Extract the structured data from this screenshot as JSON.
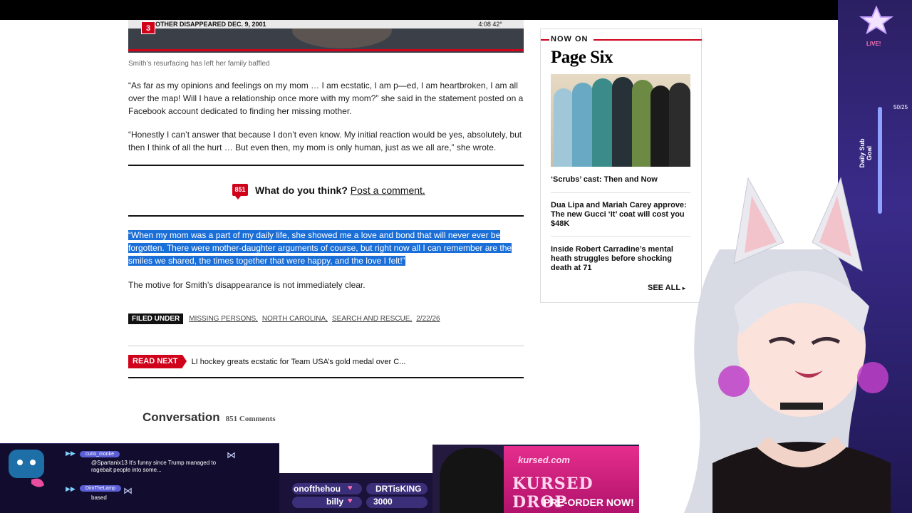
{
  "video": {
    "badge_num": "3",
    "ticker_left": "OTHER DISAPPEARED DEC. 9, 2001",
    "ticker_right": "4:08   42°"
  },
  "article": {
    "caption": "Smith’s resurfacing has left her family baffled",
    "paragraph1": "“As far as my opinions and feelings on my mom … I am ecstatic, I am p—ed, I am heartbroken, I am all over the map! Will I have a relationship once more with my mom?” she said in the statement posted on a Facebook account dedicated to finding her missing mother.",
    "paragraph2": "“Honestly I can’t answer that because I don’t even know. My initial reaction would be yes, absolutely, but then I think of all the hurt … But even then, my mom is only human, just as we all are,” she wrote.",
    "comment_count_badge": "851",
    "comment_prompt": "What do you think?",
    "comment_link": "Post a comment.",
    "quote": "“When my mom was a part of my daily life, she showed me a love and bond that will never ever be forgotten. There were mother-daughter arguments of course, but right now all I can remember are the smiles we shared, the times together that were happy, and the love I felt!”",
    "motive": "The motive for Smith’s disappearance is not immediately clear.",
    "filed_under_label": "FILED UNDER",
    "tags": [
      "MISSING PERSONS,",
      "NORTH CAROLINA,",
      "SEARCH AND RESCUE,",
      "2/22/26"
    ],
    "read_next_label": "READ NEXT",
    "read_next_title": "LI hockey greats ecstatic for Team USA’s gold medal over C...",
    "conversation_title": "Conversation",
    "conversation_count": "851 Comments"
  },
  "sidebar": {
    "now_on": "NOW ON",
    "brand": "Page Six",
    "items": [
      "‘Scrubs’ cast: Then and Now",
      "Dua Lipa and Mariah Carey approve: The new Gucci ‘It’ coat will cost you $48K",
      "Inside Robert Carradine’s mental heath struggles before shocking death at 71"
    ],
    "see_all": "SEE ALL"
  },
  "stream": {
    "live": "LIVE!",
    "goal_label": "Daily Sub Goal",
    "goal_count": "50/25",
    "chat": [
      {
        "user": "curio_monke",
        "message": "@Spartanix13 It's funny since Trump managed to ragebait people into some..."
      },
      {
        "user": "DimTheLamp",
        "message": "based"
      }
    ],
    "leaderboard": [
      {
        "name": "onofthehou",
        "value": "DRTisKING"
      },
      {
        "name": "billy",
        "value": "3000"
      }
    ],
    "merch_brand": "kursed.com",
    "merch_title": "KURSED DROP",
    "merch_cta": "PRE-ORDER NOW!"
  },
  "colors": {
    "accent_red": "#d0021b",
    "selection_blue": "#1a6ed8",
    "stream_purple": "#2b1f63"
  }
}
